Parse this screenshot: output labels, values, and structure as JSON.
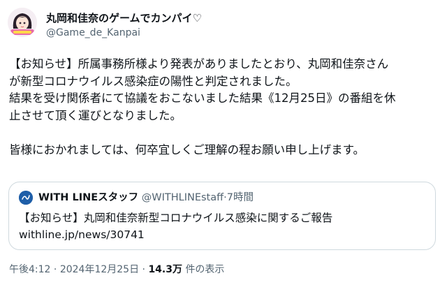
{
  "author": {
    "display_name": "丸岡和佳奈のゲームでカンパイ♡",
    "handle": "@Game_de_Kanpai"
  },
  "tweet": {
    "lines": [
      "【お知らせ】所属事務所様より発表がありましたとおり、丸岡和佳奈さん",
      "が新型コロナウイルス感染症の陽性と判定されました。",
      "結果を受け関係者にて協議をおこないました結果《12月25日》の番組を休",
      "止させて頂く運びとなりました。",
      "",
      "皆様におかれましては、何卒宜しくご理解の程お願い申し上げます。"
    ]
  },
  "quote": {
    "author_name": "WITH LINEスタッフ",
    "author_handle": "@WITHLINEstaff",
    "separator": "·",
    "time": "7時間",
    "text": "【お知らせ】丸岡和佳奈新型コロナウイルス感染に関するご報告",
    "link": "withline.jp/news/30741"
  },
  "meta": {
    "time": "午後4:12",
    "separator": "·",
    "date": "2024年12月25日",
    "views_count": "14.3万",
    "views_label": "件の表示"
  },
  "colors": {
    "text": "#0f1419",
    "secondary": "#536471",
    "border": "#cfd9de"
  }
}
